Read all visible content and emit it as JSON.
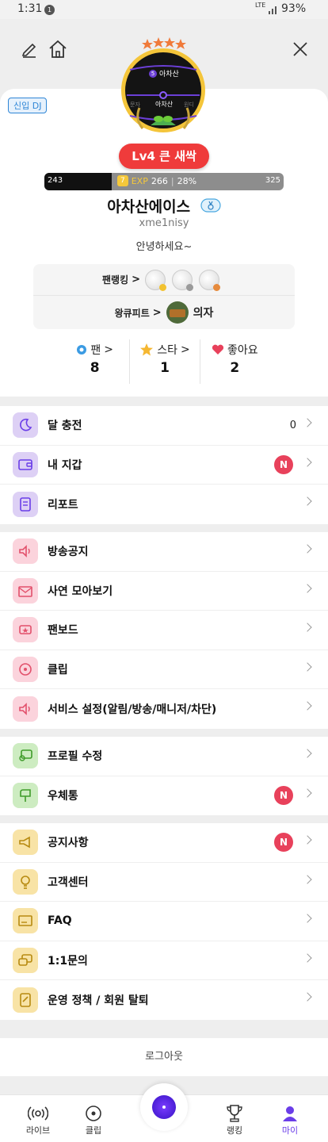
{
  "status_bar": {
    "time": "1:31",
    "notification_count": "1",
    "network": "LTE",
    "battery": "93%"
  },
  "profile": {
    "dj_badge": "신입 DJ",
    "medal": {
      "item_number": "5",
      "current_name": "아차산",
      "left_name": "문자",
      "right_name": "원디"
    },
    "level_label": "Lv4 큰 새싹",
    "exp": {
      "left_value": "243",
      "level_num": "7",
      "word": "EXP",
      "current": "266",
      "percent_text": "28%",
      "right_value": "325",
      "fill_fraction": 0.28
    },
    "nickname": "아차산에이스",
    "user_id": "xme1nisy",
    "greeting": "안녕하세요~",
    "fan_ranking_label": "팬랭킹",
    "king_cupid_label": "왕큐피트",
    "king_cupid_name": "의자"
  },
  "stats": [
    {
      "label": "팬",
      "value": "8",
      "icon": "fan-icon"
    },
    {
      "label": "스타",
      "value": "1",
      "icon": "star-icon"
    },
    {
      "label": "좋아요",
      "value": "2",
      "icon": "heart-icon"
    }
  ],
  "menu_groups": [
    [
      {
        "label": "달 충전",
        "icon": "moon-icon",
        "color": "purple",
        "count": "0"
      },
      {
        "label": "내 지갑",
        "icon": "wallet-icon",
        "color": "purple",
        "new": "N"
      },
      {
        "label": "리포트",
        "icon": "report-icon",
        "color": "purple"
      }
    ],
    [
      {
        "label": "방송공지",
        "icon": "speaker-icon",
        "color": "pink"
      },
      {
        "label": "사연 모아보기",
        "icon": "letter-icon",
        "color": "pink"
      },
      {
        "label": "팬보드",
        "icon": "fanboard-icon",
        "color": "pink"
      },
      {
        "label": "클립",
        "icon": "clip-icon",
        "color": "pink"
      },
      {
        "label": "서비스 설정(알림/방송/매니저/차단)",
        "icon": "settings-speaker-icon",
        "color": "pink"
      }
    ],
    [
      {
        "label": "프로필 수정",
        "icon": "profile-edit-icon",
        "color": "green"
      },
      {
        "label": "우체통",
        "icon": "mailbox-icon",
        "color": "green",
        "new": "N"
      }
    ],
    [
      {
        "label": "공지사항",
        "icon": "megaphone-icon",
        "color": "yellow",
        "new": "N"
      },
      {
        "label": "고객센터",
        "icon": "bulb-icon",
        "color": "yellow"
      },
      {
        "label": "FAQ",
        "icon": "faq-icon",
        "color": "yellow"
      },
      {
        "label": "1:1문의",
        "icon": "inquiry-icon",
        "color": "yellow"
      },
      {
        "label": "운영 정책 / 회원 탈퇴",
        "icon": "policy-icon",
        "color": "yellow"
      }
    ]
  ],
  "logout_label": "로그아웃",
  "bottom_nav": [
    {
      "label": "라이브",
      "icon": "live-icon"
    },
    {
      "label": "클립",
      "icon": "clip-nav-icon"
    },
    {
      "label": "랭킹",
      "icon": "trophy-icon"
    },
    {
      "label": "마이",
      "icon": "my-icon",
      "active": true
    }
  ],
  "colors": {
    "accent": "#6a3de8",
    "level_red": "#ef3b3b",
    "new_badge": "#e8415b",
    "exp_gold": "#f5c83a"
  }
}
